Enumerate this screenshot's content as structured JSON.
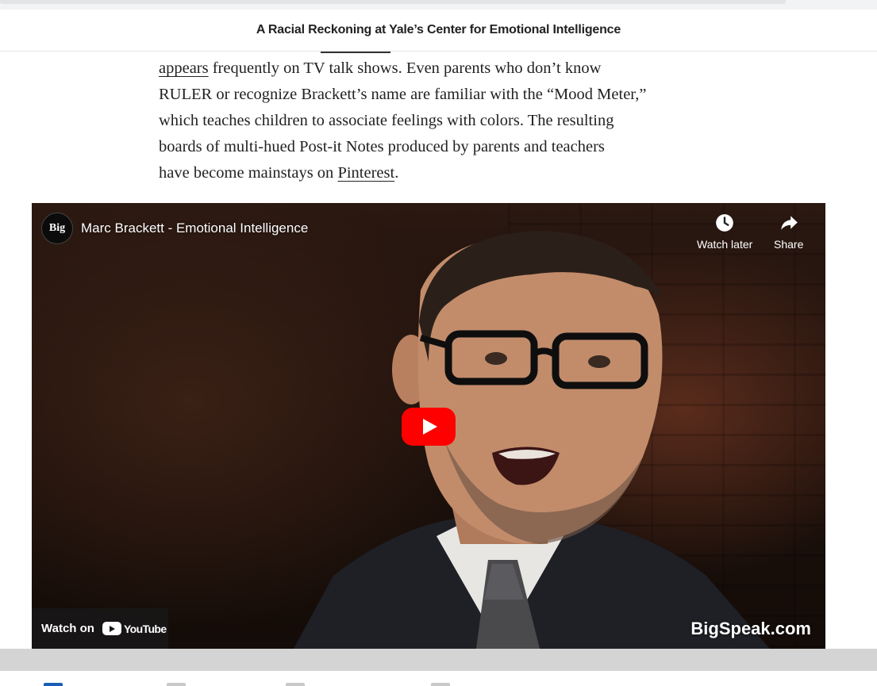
{
  "header": {
    "title": "A Racial Reckoning at Yale’s Center for Emotional Intelligence"
  },
  "article": {
    "link_appears": "appears",
    "line1_rest": " frequently on TV talk shows. Even parents who don’t know",
    "line2": "RULER or recognize Brackett’s name are familiar with the “Mood Meter,”",
    "line3": "which teaches children to associate feelings with colors. The resulting",
    "line4": "boards of multi-hued Post-it Notes produced by parents and teachers",
    "line5_start": "have become mainstays on ",
    "link_pinterest": "Pinterest",
    "line5_end": "."
  },
  "video": {
    "channel_avatar_text": "Big",
    "title": "Marc Brackett - Emotional Intelligence",
    "watch_later_label": "Watch later",
    "share_label": "Share",
    "watch_on_label": "Watch on",
    "youtube_word": "YouTube",
    "watermark": "BigSpeak.com",
    "icons": {
      "watch_later": "clock-icon",
      "share": "share-arrow-icon",
      "play": "play-icon"
    },
    "colors": {
      "play_red": "#ff0000"
    }
  }
}
